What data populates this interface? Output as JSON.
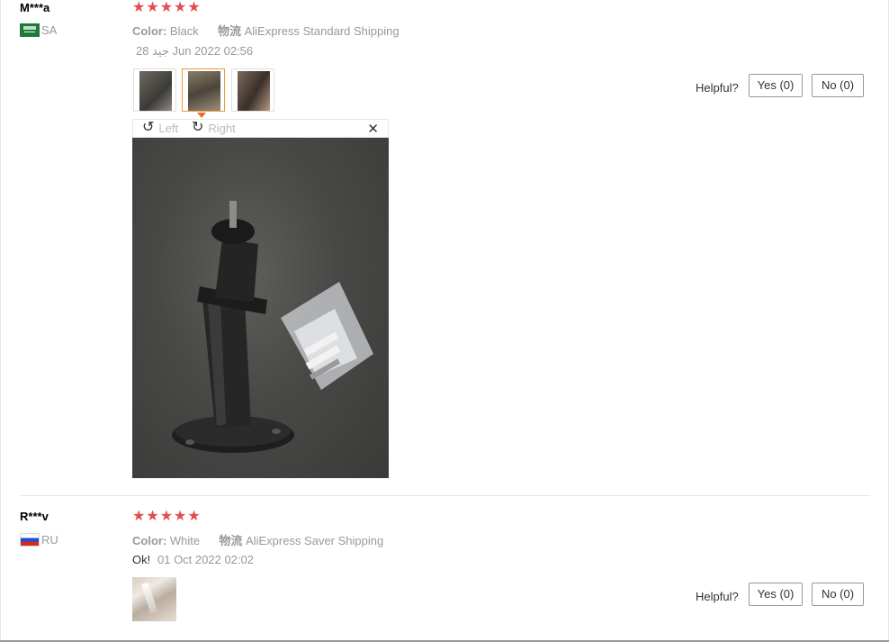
{
  "reviews": [
    {
      "user": "M***a",
      "country_code": "SA",
      "stars": [
        "★",
        "★",
        "★",
        "★",
        "★"
      ],
      "color_label": "Color:",
      "color_value": "Black",
      "shipping_label": "物流",
      "shipping_value": "AliExpress Standard Shipping",
      "date": "28 جيد Jun 2022 02:56",
      "comment": "",
      "helpful_label": "Helpful?",
      "yes_label": "Yes (0)",
      "no_label": "No (0)"
    },
    {
      "user": "R***v",
      "country_code": "RU",
      "stars": [
        "★",
        "★",
        "★",
        "★",
        "★"
      ],
      "color_label": "Color:",
      "color_value": "White",
      "shipping_label": "物流",
      "shipping_value": "AliExpress Saver Shipping",
      "date": "01 Oct 2022 02:02",
      "comment": "Ok!",
      "helpful_label": "Helpful?",
      "yes_label": "Yes (0)",
      "no_label": "No (0)"
    }
  ],
  "viewer": {
    "rotate_left_label": "Left",
    "rotate_right_label": "Right",
    "rotate_left_icon": "↺",
    "rotate_right_icon": "↻",
    "close_icon": "✕"
  },
  "colors": {
    "star": "#e04e4e",
    "active_thumb_border": "#e89a3c",
    "caret": "#e86c2c"
  }
}
